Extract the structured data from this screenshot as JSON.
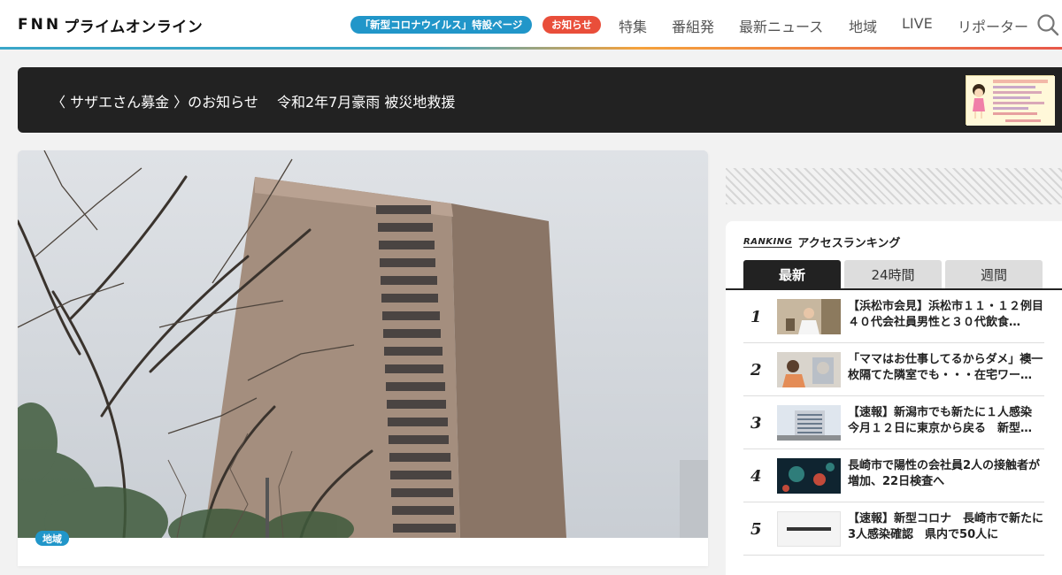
{
  "header": {
    "logo_text": "FNNプライムオンライン",
    "logo_mark": "FNN",
    "logo_sub": "プライムオンライン",
    "corona_pill": "「新型コロナウイルス」特設ページ",
    "notice_pill": "お知らせ",
    "nav": [
      "特集",
      "番組発",
      "最新ニュース",
      "地域",
      "LIVE",
      "リポーター"
    ],
    "search_icon": "search-icon"
  },
  "banner": {
    "text": "〈 サザエさん募金 〉のお知らせ　 令和2年7月豪雨 被災地救援",
    "thumb_icon": "sazae-san-fund-banner"
  },
  "article": {
    "tag": "地域"
  },
  "ranking": {
    "logo": "RANKING",
    "title": "アクセスランキング",
    "tabs": [
      "最新",
      "24時間",
      "週間"
    ],
    "active_tab": "最新",
    "items": [
      {
        "rank": "1",
        "text": "【浜松市会見】浜松市１１・１２例目　４０代会社員男性と３０代飲食…"
      },
      {
        "rank": "2",
        "text": "「ママはお仕事してるからダメ」襖一枚隔てた隣室でも・・・在宅ワー…"
      },
      {
        "rank": "3",
        "text": "【速報】新潟市でも新たに１人感染　今月１２日に東京から戻る　新型…"
      },
      {
        "rank": "4",
        "text": "長崎市で陽性の会社員2人の接触者が増加、22日検査へ"
      },
      {
        "rank": "5",
        "text": "【速報】新型コロナ　長崎市で新たに3人感染確認　県内で50人に"
      }
    ]
  },
  "colors": {
    "accent_blue": "#2196c9",
    "accent_red": "#e94e3a",
    "banner_bg": "#222222"
  }
}
